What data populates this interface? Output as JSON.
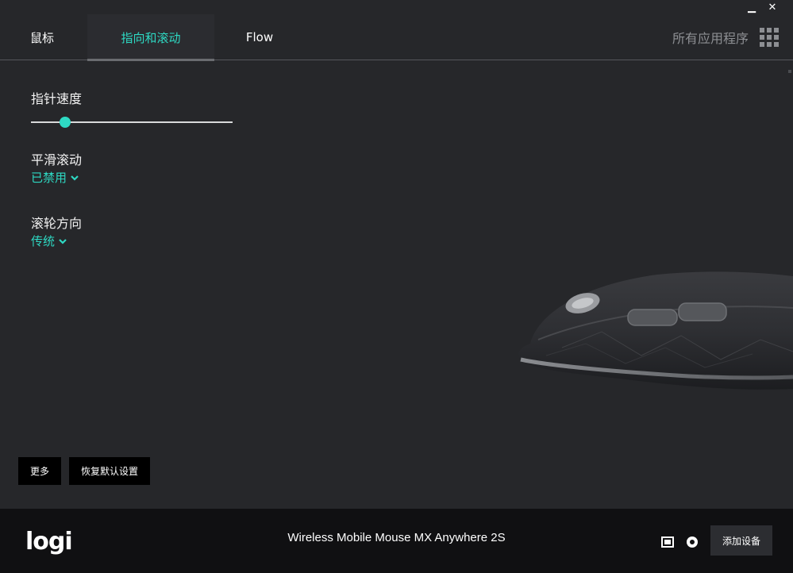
{
  "window": {
    "minimize_glyph": "▁",
    "close_glyph": "✕"
  },
  "tabs": [
    {
      "label": "鼠标",
      "active": false
    },
    {
      "label": "指向和滚动",
      "active": true
    },
    {
      "label": "Flow",
      "active": false
    }
  ],
  "all_apps": {
    "label": "所有应用程序",
    "icon": "grid-icon"
  },
  "settings": {
    "pointer_speed": {
      "title": "指针速度",
      "value_fraction": 0.17
    },
    "smooth_scroll": {
      "title": "平滑滚动",
      "value": "已禁用"
    },
    "scroll_direction": {
      "title": "滚轮方向",
      "value": "传统"
    }
  },
  "buttons": {
    "more": "更多",
    "reset": "恢复默认设置"
  },
  "footer": {
    "logo": "logi",
    "device_name": "Wireless Mobile Mouse MX Anywhere 2S",
    "add_device": "添加设备"
  },
  "colors": {
    "accent": "#2ed9c3",
    "background": "#26272a",
    "footer": "#101012"
  }
}
